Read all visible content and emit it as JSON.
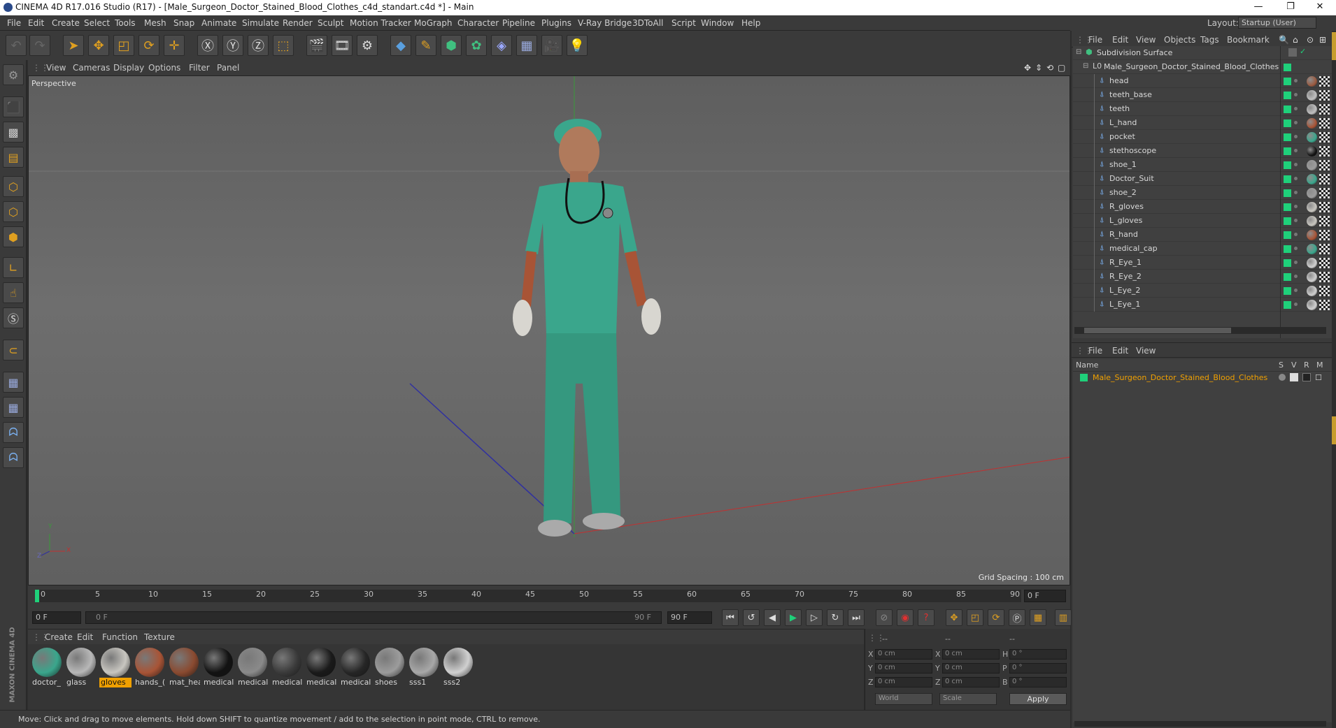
{
  "window": {
    "title": "CINEMA 4D R17.016 Studio (R17) - [Male_Surgeon_Doctor_Stained_Blood_Clothes_c4d_standart.c4d *] - Main",
    "minimize": "—",
    "restore": "❐",
    "close": "✕"
  },
  "menu": [
    "File",
    "Edit",
    "Create",
    "Select",
    "Tools",
    "Mesh",
    "Snap",
    "Animate",
    "Simulate",
    "Render",
    "Sculpt",
    "Motion Tracker",
    "MoGraph",
    "Character",
    "Pipeline",
    "Plugins",
    "V-Ray Bridge",
    "3DToAll",
    "Script",
    "Window",
    "Help"
  ],
  "layout": {
    "label": "Layout:",
    "value": "Startup (User)"
  },
  "viewport": {
    "menu": [
      "View",
      "Cameras",
      "Display",
      "Options",
      "Filter",
      "Panel"
    ],
    "name": "Perspective",
    "grid_spacing": "Grid Spacing : 100 cm",
    "axis_y": "Y",
    "axis_x": "X",
    "axis_z": "Z"
  },
  "timeline": {
    "ticks": [
      "0",
      "5",
      "10",
      "15",
      "20",
      "25",
      "30",
      "35",
      "40",
      "45",
      "50",
      "55",
      "60",
      "65",
      "70",
      "75",
      "80",
      "85",
      "90"
    ],
    "frame_field": "0 F",
    "start": "0 F",
    "range_start": "0 F",
    "range_end": "90 F",
    "end": "90 F"
  },
  "materials": {
    "menu": [
      "Create",
      "Edit",
      "Function",
      "Texture"
    ],
    "items": [
      {
        "label": "doctor_",
        "color": "#3aa68c",
        "selected": false
      },
      {
        "label": "glass",
        "color": "#b8b8b8",
        "selected": false
      },
      {
        "label": "gloves",
        "color": "#c8c6c0",
        "selected": true
      },
      {
        "label": "hands_(",
        "color": "#a85436",
        "selected": false
      },
      {
        "label": "mat_hea",
        "color": "#8a4a30",
        "selected": false
      },
      {
        "label": "medical",
        "color": "#121212",
        "selected": false
      },
      {
        "label": "medical",
        "color": "#8a8a8a",
        "selected": false
      },
      {
        "label": "medical",
        "color": "#3a3a3a",
        "selected": false
      },
      {
        "label": "medical",
        "color": "#1a1a1a",
        "selected": false
      },
      {
        "label": "medical",
        "color": "#262626",
        "selected": false
      },
      {
        "label": "shoes",
        "color": "#9c9c9c",
        "selected": false
      },
      {
        "label": "sss1",
        "color": "#a8a8a8",
        "selected": false
      },
      {
        "label": "sss2",
        "color": "#d0d0d0",
        "selected": false
      }
    ]
  },
  "coords": {
    "header": [
      "--",
      "--",
      "--"
    ],
    "rows": [
      {
        "l1": "X",
        "v1": "0 cm",
        "l2": "X",
        "v2": "0 cm",
        "l3": "H",
        "v3": "0 °"
      },
      {
        "l1": "Y",
        "v1": "0 cm",
        "l2": "Y",
        "v2": "0 cm",
        "l3": "P",
        "v3": "0 °"
      },
      {
        "l1": "Z",
        "v1": "0 cm",
        "l2": "Z",
        "v2": "0 cm",
        "l3": "B",
        "v3": "0 °"
      }
    ],
    "world": "World",
    "scale": "Scale",
    "apply": "Apply"
  },
  "status": "Move: Click and drag to move elements. Hold down SHIFT to quantize movement / add to the selection in point mode, CTRL to remove.",
  "objects": {
    "menu": [
      "File",
      "Edit",
      "View",
      "Objects",
      "Tags",
      "Bookmark"
    ],
    "root": "Subdivision Surface",
    "group": "Male_Surgeon_Doctor_Stained_Blood_Clothes",
    "children": [
      {
        "name": "head",
        "thumb": "#9a5a40"
      },
      {
        "name": "teeth_base",
        "thumb": "#bfbfbf"
      },
      {
        "name": "teeth",
        "thumb": "#bfbfbf"
      },
      {
        "name": "L_hand",
        "thumb": "#a85436"
      },
      {
        "name": "pocket",
        "thumb": "#3aa68c"
      },
      {
        "name": "stethoscope",
        "thumb": "#121212"
      },
      {
        "name": "shoe_1",
        "thumb": "#9c9c9c"
      },
      {
        "name": "Doctor_Suit",
        "thumb": "#3aa68c"
      },
      {
        "name": "shoe_2",
        "thumb": "#9c9c9c"
      },
      {
        "name": "R_gloves",
        "thumb": "#c8c6c0"
      },
      {
        "name": "L_gloves",
        "thumb": "#c8c6c0"
      },
      {
        "name": "R_hand",
        "thumb": "#a85436"
      },
      {
        "name": "medical_cap",
        "thumb": "#3aa68c"
      },
      {
        "name": "R_Eye_1",
        "thumb": "#d0d0d0"
      },
      {
        "name": "R_Eye_2",
        "thumb": "#d0d0d0"
      },
      {
        "name": "L_Eye_2",
        "thumb": "#d0d0d0"
      },
      {
        "name": "L_Eye_1",
        "thumb": "#d0d0d0"
      }
    ]
  },
  "attributes": {
    "menu": [
      "File",
      "Edit",
      "View"
    ],
    "col_name": "Name",
    "cols": [
      "S",
      "V",
      "R",
      "M"
    ],
    "item": "Male_Surgeon_Doctor_Stained_Blood_Clothes"
  },
  "brand": "MAXON CINEMA 4D",
  "colors": {
    "accent": "#f0a000",
    "layer_green": "#1fd07a",
    "scrub_green": "#1fd07a"
  }
}
